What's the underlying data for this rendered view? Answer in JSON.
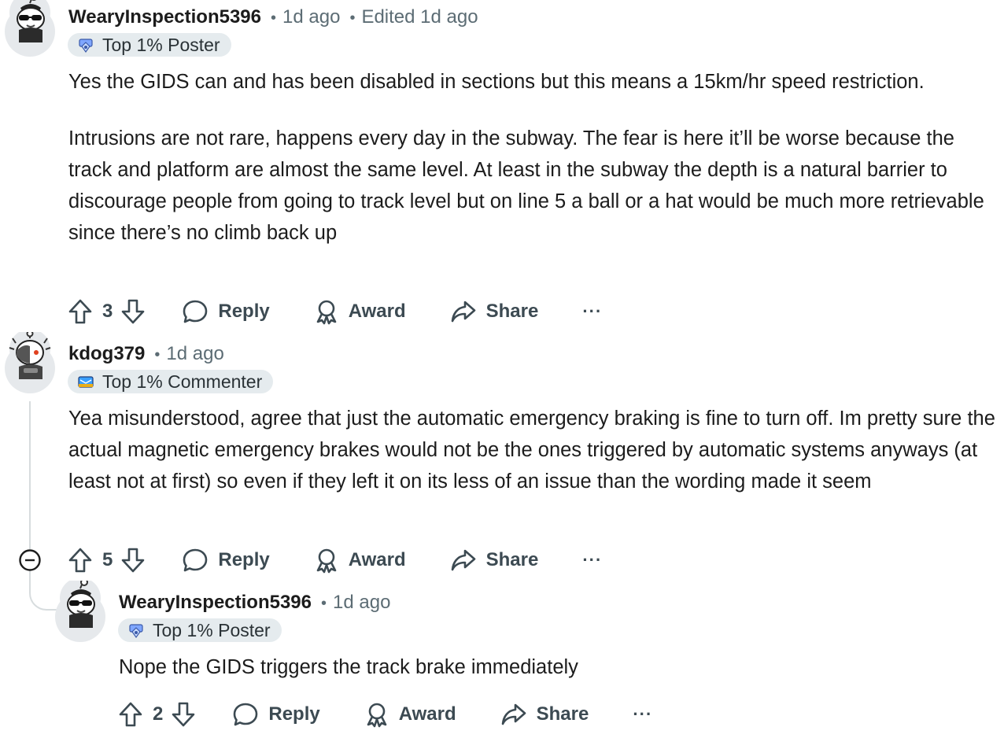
{
  "comments": [
    {
      "author": "WearyInspection5396",
      "time": "1d ago",
      "edited": "Edited 1d ago",
      "flair": "Top 1% Poster",
      "paragraphs": [
        "Yes the GIDS can and has been disabled in sections but this means a 15km/hr speed restriction.",
        "Intrusions are not rare, happens every day in the subway. The fear is here it’ll be worse because the track and platform are almost the same level. At least in the subway the depth is a natural barrier to discourage people from going to track level but on line 5 a ball or a hat would be much more retrievable since there’s no climb back up"
      ],
      "votes": "3",
      "actions": {
        "reply": "Reply",
        "award": "Award",
        "share": "Share",
        "more": "···"
      }
    },
    {
      "author": "kdog379",
      "time": "1d ago",
      "flair": "Top 1% Commenter",
      "paragraphs": [
        "Yea misunderstood, agree that just the automatic emergency braking is fine to turn off. Im pretty sure the actual magnetic emergency brakes would not be the ones triggered by automatic systems anyways (at least not at first) so even if they left it on its less of an issue than the wording made it seem"
      ],
      "votes": "5",
      "actions": {
        "reply": "Reply",
        "award": "Award",
        "share": "Share",
        "more": "···"
      }
    },
    {
      "author": "WearyInspection5396",
      "time": "1d ago",
      "flair": "Top 1% Poster",
      "paragraphs": [
        "Nope the GIDS triggers the track brake immediately"
      ],
      "votes": "2",
      "actions": {
        "reply": "Reply",
        "award": "Award",
        "share": "Share",
        "more": "···"
      }
    }
  ],
  "icons": {
    "upvote": "upvote-icon",
    "downvote": "downvote-icon",
    "reply": "speech-bubble-icon",
    "award": "award-ribbon-icon",
    "share": "share-arrow-icon",
    "collapse": "collapse-minus-icon"
  },
  "colors": {
    "text": "#1c1c1c",
    "meta": "#5c6c74",
    "flair_bg": "#e5ebee",
    "action": "#3c4a52"
  }
}
